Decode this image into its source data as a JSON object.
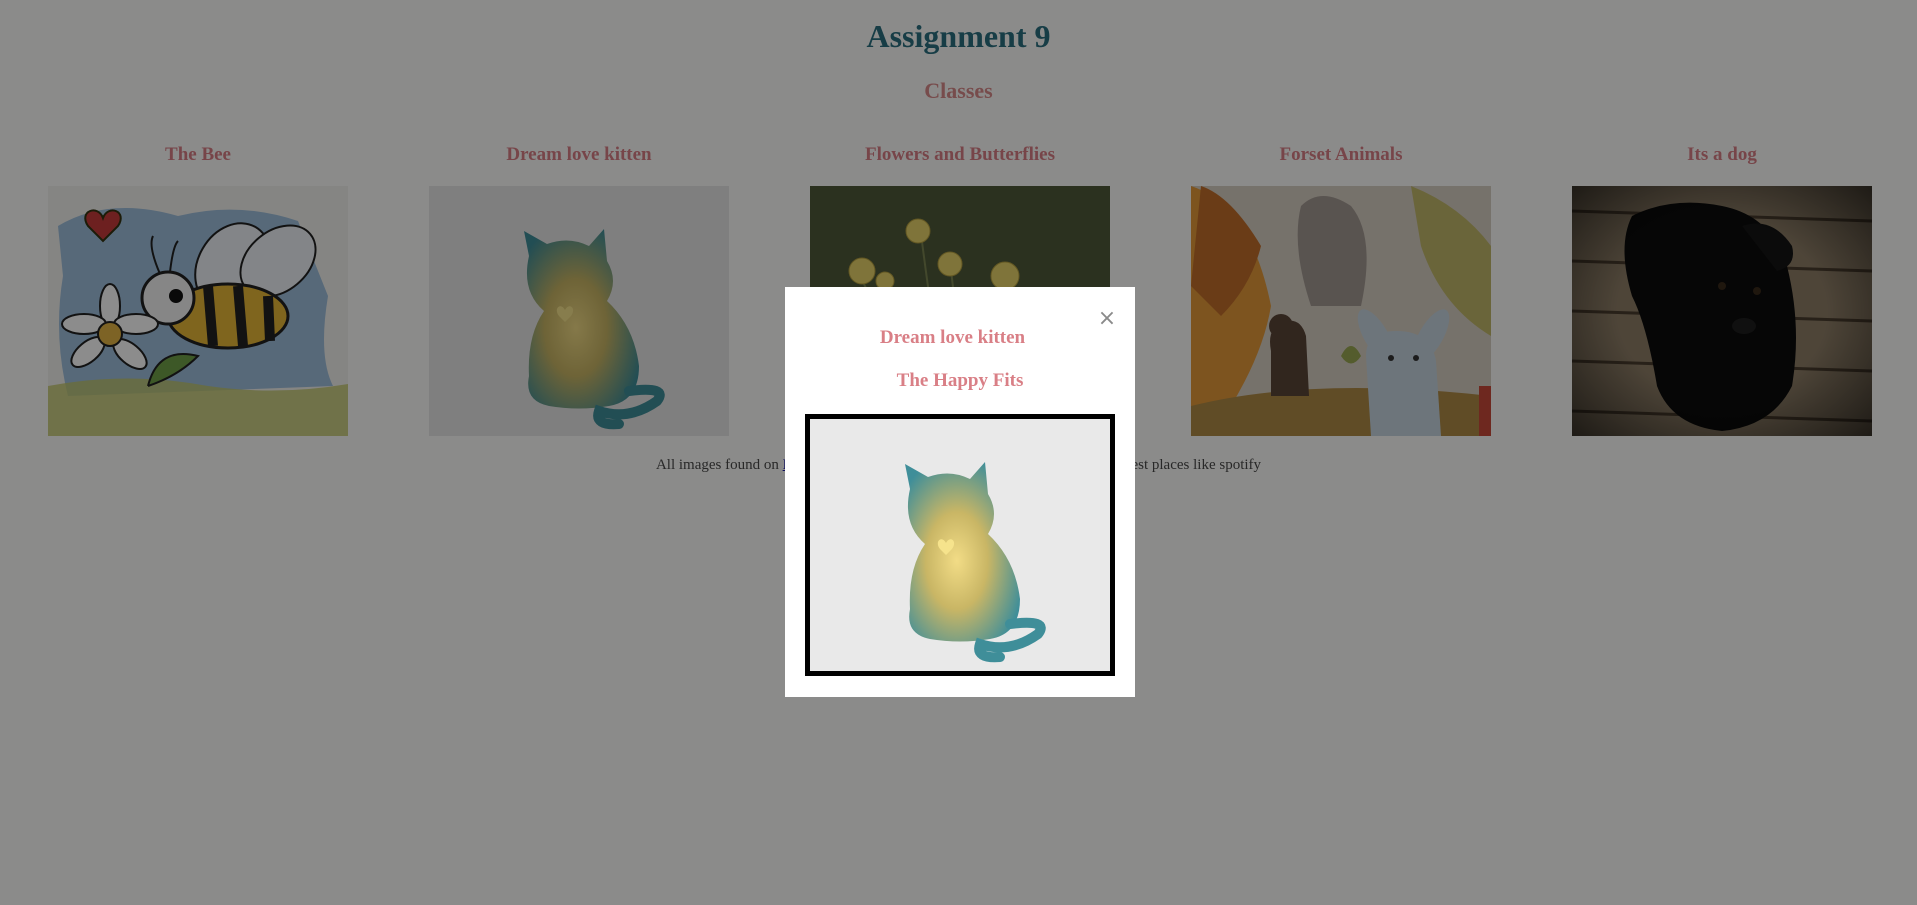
{
  "page": {
    "title": "Assignment 9",
    "subtitle": "Classes"
  },
  "cards": [
    {
      "title": "The Bee",
      "image_icon": "bee-and-daisy-illustration"
    },
    {
      "title": "Dream love kitten",
      "image_icon": "cat-silhouette-with-heart"
    },
    {
      "title": "Flowers and Butterflies",
      "image_icon": "yellow-flowers-on-dark"
    },
    {
      "title": "Forset Animals",
      "image_icon": "forest-bear-and-rabbit"
    },
    {
      "title": "Its a dog",
      "image_icon": "black-puppy-photo"
    }
  ],
  "footer": {
    "prefix": "All images found on ",
    "link_visible": "P",
    "suffix": "dest places like spotify"
  },
  "modal": {
    "title": "Dream love kitten",
    "subtitle": "The Happy Fits",
    "close_symbol": "×",
    "image_icon": "cat-silhouette-with-heart"
  },
  "colors": {
    "title": "#2a6f80",
    "accent": "#d97f86",
    "overlay": "rgba(0,0,0,0.45)"
  }
}
